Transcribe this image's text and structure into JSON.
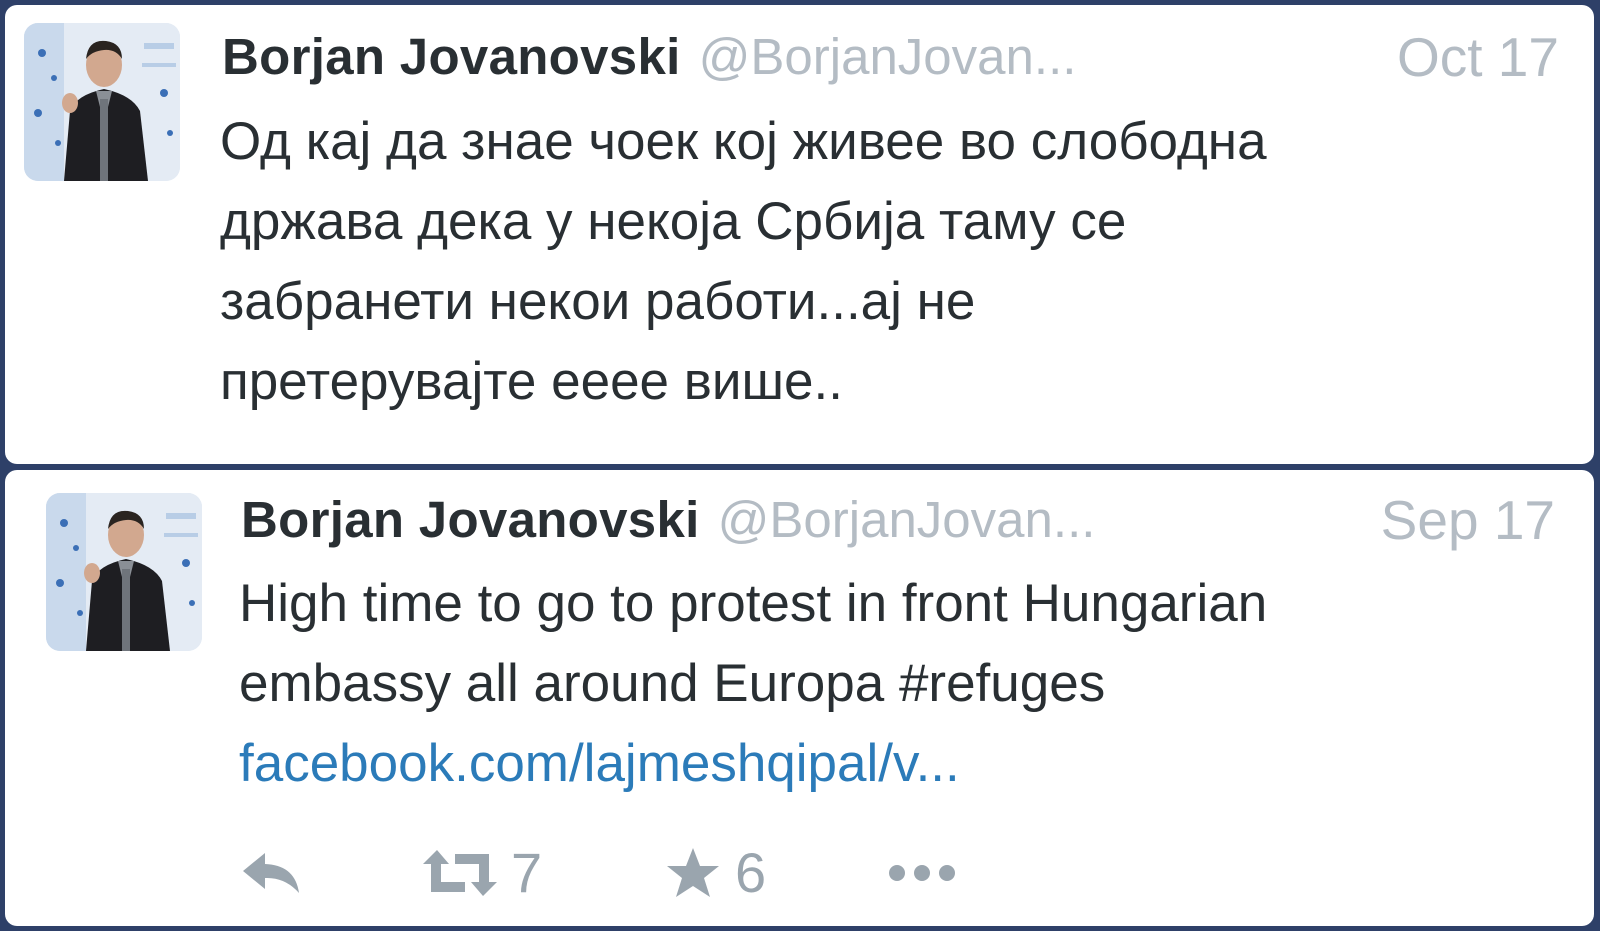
{
  "tweets": [
    {
      "name": "Borjan Jovanovski",
      "handle": "@BorjanJovan...",
      "date": "Oct 17",
      "lines": [
        "Од кај да знае чоек кој живее во слободна",
        "држава дека у некоја Србија таму се",
        "забранети некои работи...ај не",
        "претерувајте ееее више.."
      ]
    },
    {
      "name": "Borjan Jovanovski",
      "handle": "@BorjanJovan...",
      "date": "Sep 17",
      "lines": [
        "High time to go to protest in front Hungarian",
        "embassy all around Europa #refuges"
      ],
      "link": "facebook.com/lajmeshqipal/v...",
      "actions": {
        "reply_icon": "reply-icon",
        "retweet_icon": "retweet-icon",
        "retweet_count": "7",
        "favorite_icon": "star-icon",
        "favorite_count": "6",
        "more_icon": "more-dots-icon"
      }
    }
  ],
  "colors": {
    "background": "#2e4068",
    "card": "#ffffff",
    "name_text": "#292f33",
    "muted_text": "#b4bcc4",
    "link": "#2b7bb9",
    "action_icon": "#9aa5ae"
  }
}
